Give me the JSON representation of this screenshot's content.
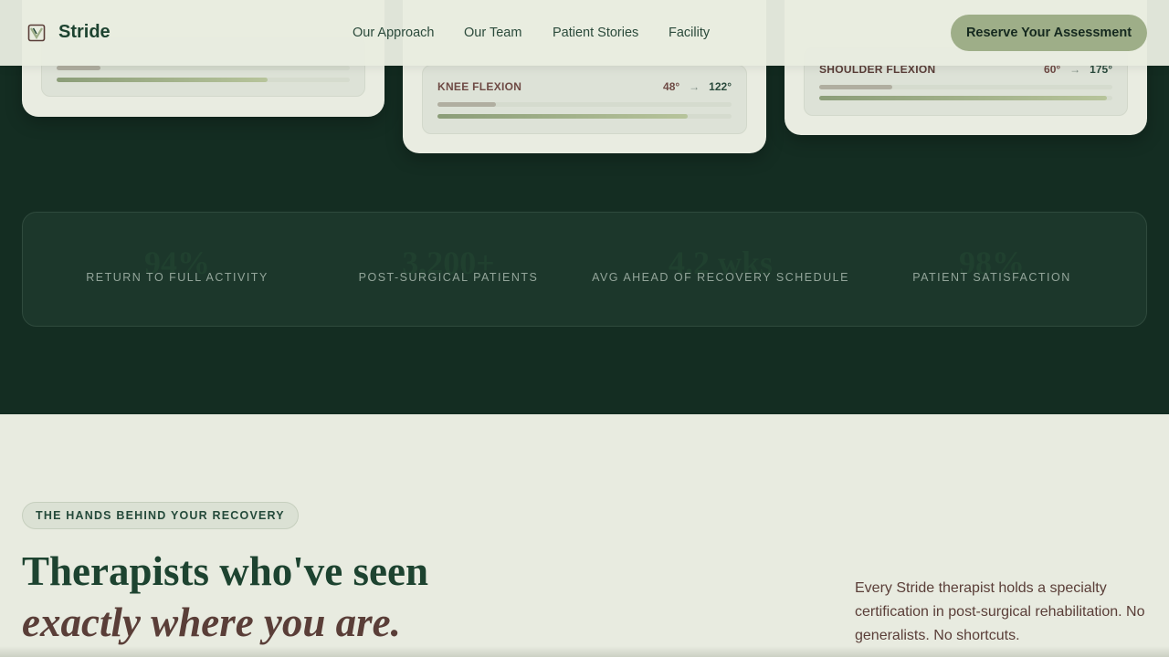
{
  "brand": {
    "name": "Stride",
    "logo_icon": "shield-leaf-icon"
  },
  "nav": {
    "items": [
      "Our Approach",
      "Our Team",
      "Patient Stories",
      "Facility"
    ]
  },
  "cta": {
    "label": "Reserve Your Assessment"
  },
  "progress_cards": [
    {
      "metric": "",
      "before": "",
      "after": "",
      "before_progress": 0.15,
      "after_progress": 0.72
    },
    {
      "metric": "KNEE FLEXION",
      "before": "48°",
      "after": "122°",
      "before_progress": 0.2,
      "after_progress": 0.85
    },
    {
      "metric": "SHOULDER FLEXION",
      "before": "60°",
      "after": "175°",
      "before_progress": 0.25,
      "after_progress": 0.98
    }
  ],
  "stats": [
    {
      "value": "94%",
      "label": "RETURN TO FULL ACTIVITY"
    },
    {
      "value": "3,200+",
      "label": "POST-SURGICAL PATIENTS"
    },
    {
      "value": "4.2 wks",
      "label": "AVG AHEAD OF RECOVERY SCHEDULE"
    },
    {
      "value": "98%",
      "label": "PATIENT SATISFACTION"
    }
  ],
  "team_section": {
    "eyebrow": "THE HANDS BEHIND YOUR RECOVERY",
    "heading_line1": "Therapists who've seen",
    "heading_line2": "exactly where you are.",
    "description": "Every Stride therapist holds a specialty certification in post-surgical rehabilitation. No generalists. No shortcuts."
  },
  "colors": {
    "dark_bg": "#142d22",
    "light_bg": "#e8ebe0",
    "accent": "#9eae88",
    "brand_green": "#1d4330",
    "brand_brown": "#5a3e38"
  }
}
